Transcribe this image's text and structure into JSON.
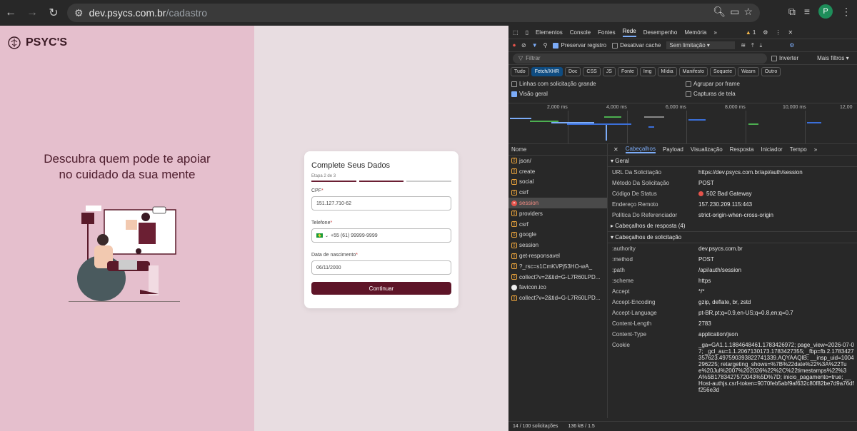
{
  "browser": {
    "url_host": "dev.psycs.com.br",
    "url_path": "/cadastro",
    "profile_initial": "P"
  },
  "site": {
    "logo_text": "PSYC'S",
    "hero_line1": "Descubra quem pode te apoiar",
    "hero_line2": "no cuidado da sua mente"
  },
  "form": {
    "title": "Complete Seus Dados",
    "step": "Etapa 2 de 3",
    "cpf_label": "CPF",
    "cpf_value": "151.127.710-62",
    "phone_label": "Telefone",
    "phone_value": "+55 (61) 99999-9999",
    "birth_label": "Data de nascimento",
    "birth_value": "06/11/2000",
    "submit": "Continuar"
  },
  "devtools": {
    "tabs": [
      "Elementos",
      "Console",
      "Fontes",
      "Rede",
      "Desempenho",
      "Memória"
    ],
    "warnings": "1",
    "preserve_log": "Preservar registro",
    "disable_cache": "Desativar cache",
    "throttle": "Sem limitação",
    "filter_placeholder": "Filtrar",
    "invert": "Inverter",
    "more_filters": "Mais filtros",
    "types": [
      "Tudo",
      "Fetch/XHR",
      "Doc",
      "CSS",
      "JS",
      "Fonte",
      "Img",
      "Mídia",
      "Manifesto",
      "Soquete",
      "Wasm",
      "Outro"
    ],
    "opt_large_rows": "Linhas com solicitação grande",
    "opt_group_frame": "Agrupar por frame",
    "opt_overview": "Visão geral",
    "opt_screenshots": "Capturas de tela",
    "ticks": [
      "2,000 ms",
      "4,000 ms",
      "6,000 ms",
      "8,000 ms",
      "10,000 ms",
      "12,00"
    ],
    "name_header": "Nome",
    "requests": [
      {
        "name": "json/",
        "kind": "xhr"
      },
      {
        "name": "create",
        "kind": "xhr"
      },
      {
        "name": "social",
        "kind": "xhr"
      },
      {
        "name": "csrf",
        "kind": "xhr"
      },
      {
        "name": "session",
        "kind": "error"
      },
      {
        "name": "providers",
        "kind": "xhr"
      },
      {
        "name": "csrf",
        "kind": "xhr"
      },
      {
        "name": "google",
        "kind": "xhr"
      },
      {
        "name": "session",
        "kind": "xhr"
      },
      {
        "name": "get-responsavel",
        "kind": "xhr"
      },
      {
        "name": "?_rsc=s1CmKVPj53HO-wA_",
        "kind": "doc"
      },
      {
        "name": "collect?v=2&tid=G-L7R60LPD...",
        "kind": "doc"
      },
      {
        "name": "favicon.ico",
        "kind": "img"
      },
      {
        "name": "collect?v=2&tid=G-L7R60LPD...",
        "kind": "doc"
      }
    ],
    "detail_tabs": [
      "Cabeçalhos",
      "Payload",
      "Visualização",
      "Resposta",
      "Iniciador",
      "Tempo"
    ],
    "general_title": "Geral",
    "general": [
      {
        "k": "URL Da Solicitação",
        "v": "https://dev.psycs.com.br/api/auth/session"
      },
      {
        "k": "Método Da Solicitação",
        "v": "POST"
      },
      {
        "k": "Código De Status",
        "v": "502 Bad Gateway"
      },
      {
        "k": "Endereço Remoto",
        "v": "157.230.209.115:443"
      },
      {
        "k": "Política Do Referenciador",
        "v": "strict-origin-when-cross-origin"
      }
    ],
    "resp_headers_title": "Cabeçalhos de resposta (4)",
    "req_headers_title": "Cabeçalhos de solicitação",
    "req_headers": [
      {
        "k": ":authority",
        "v": "dev.psycs.com.br"
      },
      {
        "k": ":method",
        "v": "POST"
      },
      {
        "k": ":path",
        "v": "/api/auth/session"
      },
      {
        "k": ":scheme",
        "v": "https"
      },
      {
        "k": "Accept",
        "v": "*/*"
      },
      {
        "k": "Accept-Encoding",
        "v": "gzip, deflate, br, zstd"
      },
      {
        "k": "Accept-Language",
        "v": "pt-BR,pt;q=0.9,en-US;q=0.8,en;q=0.7"
      },
      {
        "k": "Content-Length",
        "v": "2783"
      },
      {
        "k": "Content-Type",
        "v": "application/json"
      },
      {
        "k": "Cookie",
        "v": "_ga=GA1.1.1884648461.1783426972; page_view=2026-07-07; _gcl_au=1.1.2067130173.1783427355; _fbp=fb.2.1783427357623.497590393822741339.AQYAAQIB; __insp_uid=1004296225; retargeting_shows=%7B%22date%22%3A%22Tue%20Jul%2007%202026%22%2C%22timestamps%22%3A%5B1783427572043%5D%7D; inicio_pagamento=true; __Host-authjs.csrf-token=9070feb5abf9af632c80f82be7d9a76dff256e3d"
      }
    ],
    "status_requests": "14 / 100 solicitações",
    "status_size": "136 kB / 1.5"
  }
}
